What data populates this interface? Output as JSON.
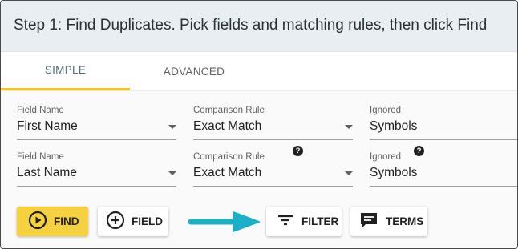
{
  "header": {
    "title": "Step 1: Find Duplicates. Pick fields and matching rules, then click Find"
  },
  "tabs": [
    {
      "label": "SIMPLE",
      "active": true
    },
    {
      "label": "ADVANCED",
      "active": false
    }
  ],
  "rows": [
    {
      "field_name": {
        "label": "Field Name",
        "value": "First Name"
      },
      "comparison_rule": {
        "label": "Comparison Rule",
        "value": "Exact Match"
      },
      "ignored": {
        "label": "Ignored",
        "value": "Symbols"
      }
    },
    {
      "field_name": {
        "label": "Field Name",
        "value": "Last Name"
      },
      "comparison_rule": {
        "label": "Comparison Rule",
        "value": "Exact Match"
      },
      "ignored": {
        "label": "Ignored",
        "value": "Symbols"
      }
    }
  ],
  "help_glyph": "?",
  "buttons": {
    "find": "FIND",
    "field": "FIELD",
    "filter": "FILTER",
    "terms": "TERMS"
  },
  "icons": {
    "find": "play-circle-icon",
    "field": "add-circle-icon",
    "filter": "filter-list-icon",
    "terms": "comment-icon",
    "help": "help-icon",
    "annotation": "arrow-right-icon"
  },
  "colors": {
    "accent": "#f5c518",
    "find_button": "#f5d03f",
    "header_bg": "#e9eef3",
    "annotation_arrow": "#1ab0c8"
  }
}
